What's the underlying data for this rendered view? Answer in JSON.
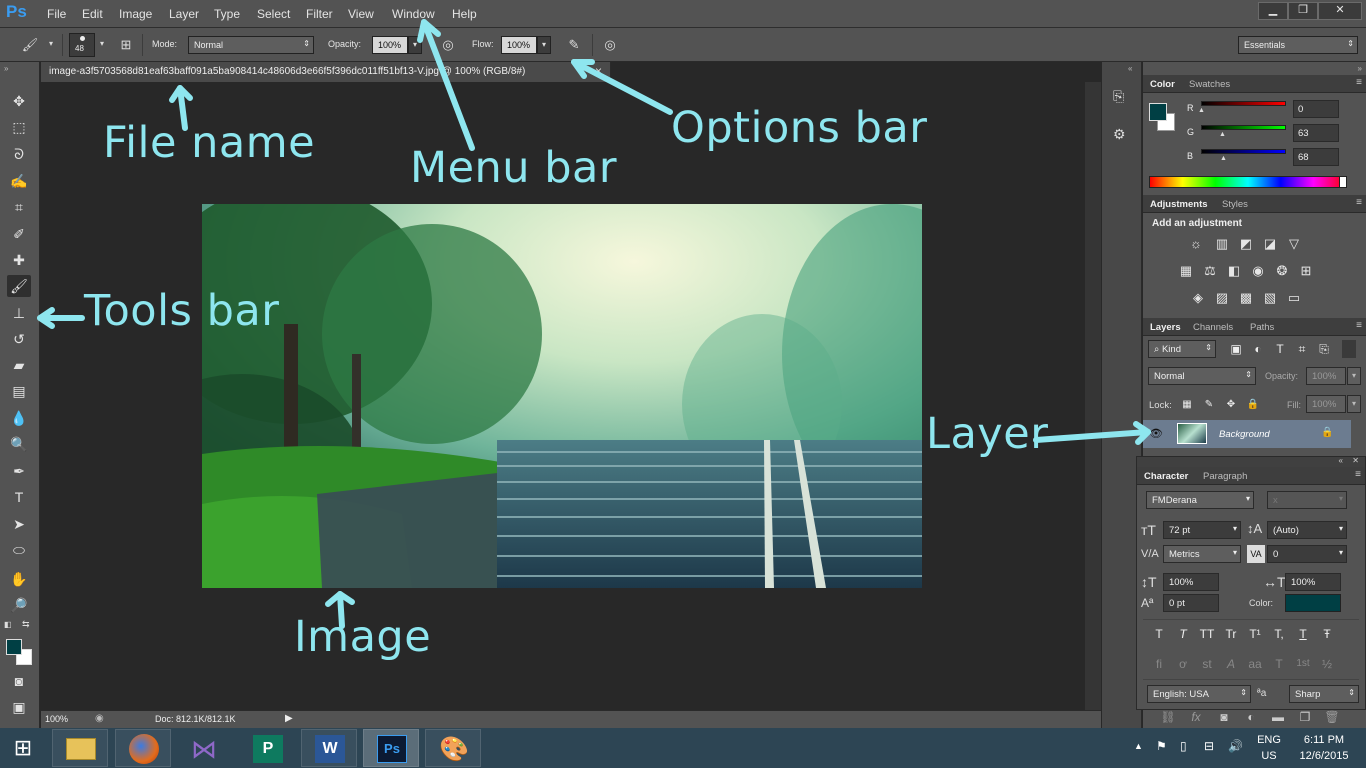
{
  "app": {
    "logo": "Ps"
  },
  "menu": [
    "File",
    "Edit",
    "Image",
    "Layer",
    "Type",
    "Select",
    "Filter",
    "View",
    "Window",
    "Help"
  ],
  "window_controls": {
    "minimize": "▁",
    "restore": "❐",
    "close": "✕"
  },
  "options": {
    "brush_size": "48",
    "mode_label": "Mode:",
    "mode_value": "Normal",
    "opacity_label": "Opacity:",
    "opacity_value": "100%",
    "flow_label": "Flow:",
    "flow_value": "100%",
    "workspace": "Essentials"
  },
  "document": {
    "tab_title": "image-a3f5703568d81eaf63baff091a5ba908414c48606d3e66f5f396dc011ff51bf13-V.jpg @ 100% (RGB/8#)",
    "close": "×",
    "zoom": "100%",
    "doc_size": "Doc: 812.1K/812.1K"
  },
  "color_panel": {
    "tabs": [
      "Color",
      "Swatches"
    ],
    "channels": [
      {
        "label": "R",
        "value": "0",
        "gradient": [
          "#000000",
          "#ff0000"
        ]
      },
      {
        "label": "G",
        "value": "63",
        "gradient": [
          "#000000",
          "#00ff00"
        ]
      },
      {
        "label": "B",
        "value": "68",
        "gradient": [
          "#000000",
          "#0000ff"
        ]
      }
    ],
    "foreground": "#003f44",
    "background": "#ffffff"
  },
  "adjustments_panel": {
    "tabs": [
      "Adjustments",
      "Styles"
    ],
    "heading": "Add an adjustment",
    "icons": [
      "brightness-icon",
      "levels-icon",
      "curves-icon",
      "exposure-icon",
      "vibrance-icon",
      "hue-sat-icon",
      "color-balance-icon",
      "bw-icon",
      "photo-filter-icon",
      "channel-mixer-icon",
      "color-lookup-icon",
      "invert-icon",
      "posterize-icon",
      "threshold-icon",
      "gradient-map-icon",
      "selective-color-icon"
    ]
  },
  "layers_panel": {
    "tabs": [
      "Layers",
      "Channels",
      "Paths"
    ],
    "kind": "Kind",
    "blend": "Normal",
    "opacity_label": "Opacity:",
    "opacity_value": "100%",
    "lock_label": "Lock:",
    "fill_label": "Fill:",
    "fill_value": "100%",
    "layers": [
      {
        "name": "Background",
        "visible": true,
        "locked": true
      }
    ]
  },
  "character_panel": {
    "tabs": [
      "Character",
      "Paragraph"
    ],
    "font": "FMDerana",
    "style": "x",
    "size": "72 pt",
    "leading": "(Auto)",
    "kerning": "Metrics",
    "tracking": "0",
    "vscale": "100%",
    "hscale": "100%",
    "baseline": "0 pt",
    "color_label": "Color:",
    "color": "#003f44",
    "type_styles": [
      "T",
      "T",
      "TT",
      "Tr",
      "T¹",
      "T,",
      "T",
      "Ŧ"
    ],
    "opentype": [
      "fi",
      "ơ",
      "st",
      "A",
      "aa",
      "T",
      "1st",
      "½"
    ],
    "language": "English: USA",
    "aa_label": "ªa",
    "antialias": "Sharp"
  },
  "taskbar": {
    "lang": "ENG",
    "region": "US",
    "time": "6:11 PM",
    "date": "12/6/2015"
  },
  "annotations": {
    "file_name": "File name",
    "menu_bar": "Menu bar",
    "options_bar": "Options bar",
    "tools_bar": "Tools bar",
    "layer": "Layer",
    "image": "Image"
  },
  "colors": {
    "annotation": "#8ee6ef",
    "ui_panel": "#535353",
    "canvas": "#282828"
  }
}
